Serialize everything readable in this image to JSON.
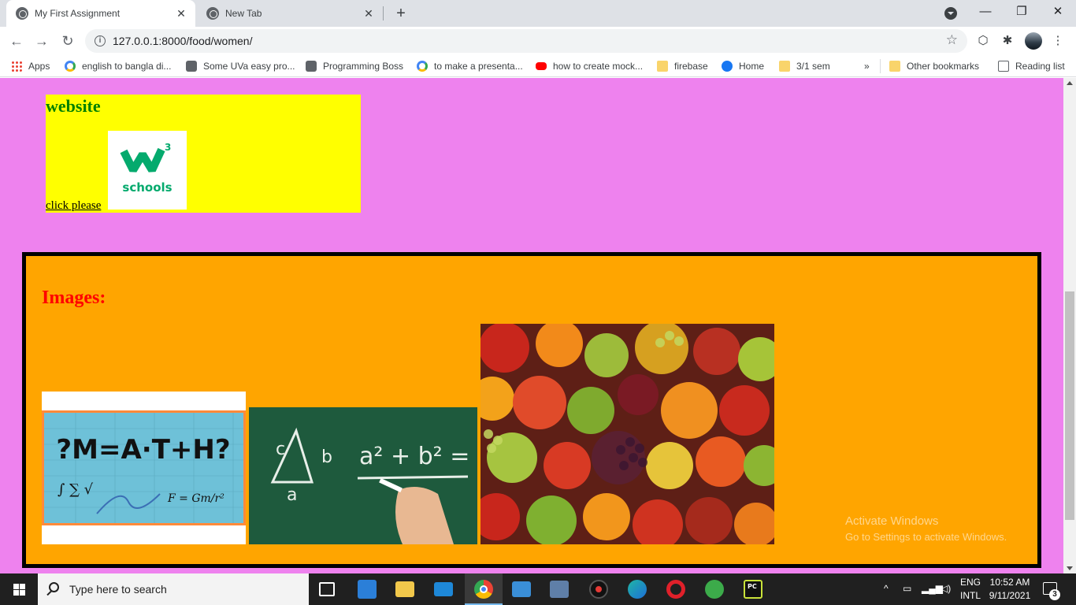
{
  "browser": {
    "tabs": [
      {
        "title": "My First Assignment",
        "close": "✕"
      },
      {
        "title": "New Tab",
        "close": "✕"
      }
    ],
    "new_tab": "+",
    "window": {
      "minimize": "—",
      "maximize": "❐",
      "close": "✕"
    },
    "url": "127.0.0.1:8000/food/women/",
    "bookmarks": [
      {
        "label": "Apps",
        "icon": "apps-icon"
      },
      {
        "label": "english to bangla di...",
        "icon": "google-icon"
      },
      {
        "label": "Some UVa easy pro...",
        "icon": "site-icon"
      },
      {
        "label": "Programming Boss",
        "icon": "site-icon"
      },
      {
        "label": "to make a presenta...",
        "icon": "google-icon"
      },
      {
        "label": "how to create mock...",
        "icon": "youtube-icon"
      },
      {
        "label": "firebase",
        "icon": "folder-icon"
      },
      {
        "label": "Home",
        "icon": "facebook-icon"
      },
      {
        "label": "3/1 sem",
        "icon": "folder-icon"
      }
    ],
    "bookmarks_overflow": "»",
    "other_bookmarks": "Other bookmarks",
    "reading_list": "Reading list"
  },
  "page": {
    "website": {
      "heading": "website",
      "link_text": "click please",
      "logo_text": "schools",
      "logo_sup": "3",
      "colors": {
        "box": "#ffff00",
        "heading": "#008000",
        "logo": "#04aa6d"
      }
    },
    "images": {
      "heading": "Images:",
      "items": [
        {
          "name": "math",
          "text": "?M=A·T+H?"
        },
        {
          "name": "pythagoras",
          "text": "a² + b² = c²"
        },
        {
          "name": "fruits"
        }
      ],
      "colors": {
        "box": "#ffa500",
        "border": "#000000",
        "heading": "#ff0000"
      }
    },
    "background": "#ee82ee"
  },
  "watermark": {
    "line1": "Activate Windows",
    "line2": "Go to Settings to activate Windows."
  },
  "taskbar": {
    "search_placeholder": "Type here to search",
    "lang_top": "ENG",
    "lang_bottom": "INTL",
    "time": "10:52 AM",
    "date": "9/11/2021",
    "notifications": "3"
  }
}
